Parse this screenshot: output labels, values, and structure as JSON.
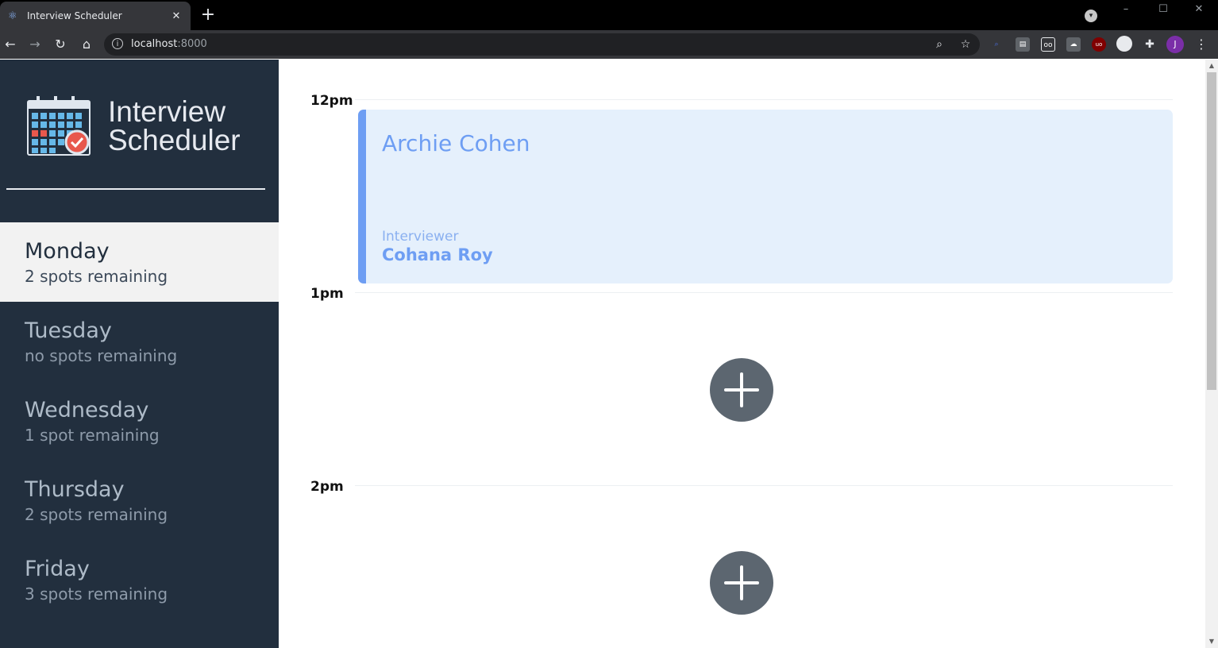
{
  "browser": {
    "tab_title": "Interview Scheduler",
    "url_host": "localhost",
    "url_port": ":8000",
    "profile_initial": "J"
  },
  "app": {
    "name_line1": "Interview",
    "name_line2": "Scheduler"
  },
  "days": [
    {
      "name": "Monday",
      "spots": "2 spots remaining",
      "selected": true
    },
    {
      "name": "Tuesday",
      "spots": "no spots remaining",
      "selected": false
    },
    {
      "name": "Wednesday",
      "spots": "1 spot remaining",
      "selected": false
    },
    {
      "name": "Thursday",
      "spots": "2 spots remaining",
      "selected": false
    },
    {
      "name": "Friday",
      "spots": "3 spots remaining",
      "selected": false
    }
  ],
  "schedule": {
    "times": [
      "12pm",
      "1pm",
      "2pm"
    ],
    "appointment": {
      "student": "Archie Cohen",
      "interviewer_label": "Interviewer",
      "interviewer": "Cohana Roy"
    }
  },
  "colors": {
    "sidebar_bg": "#222f3e",
    "accent": "#6e9ef3",
    "appointment_bg": "#e5f0fc",
    "add_button": "#5c6670"
  }
}
